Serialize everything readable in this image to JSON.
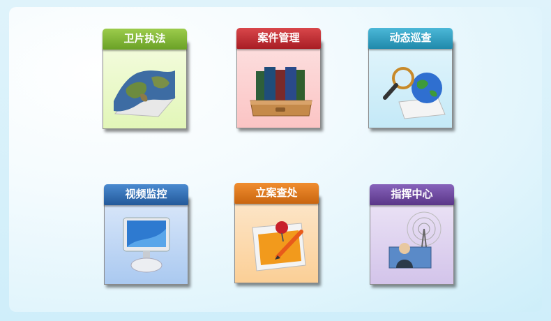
{
  "tiles": [
    {
      "label": "卫片执法",
      "icon": "satellite-map-icon",
      "header_color": "#7fb534",
      "body_color": "#eaf8c8"
    },
    {
      "label": "案件管理",
      "icon": "books-tray-icon",
      "header_color": "#c42c33",
      "body_color": "#fccaca"
    },
    {
      "label": "动态巡查",
      "icon": "magnifier-globe-icon",
      "header_color": "#2c9fc2",
      "body_color": "#ccecf8"
    },
    {
      "label": "视频监控",
      "icon": "computer-monitor-icon",
      "header_color": "#2f6eb2",
      "body_color": "#c7dcf5"
    },
    {
      "label": "立案查处",
      "icon": "pinned-document-pencil-icon",
      "header_color": "#e07a1a",
      "body_color": "#fcd9b0"
    },
    {
      "label": "指挥中心",
      "icon": "signal-tower-operator-icon",
      "header_color": "#6e4aa0",
      "body_color": "#ddd0ee"
    }
  ]
}
